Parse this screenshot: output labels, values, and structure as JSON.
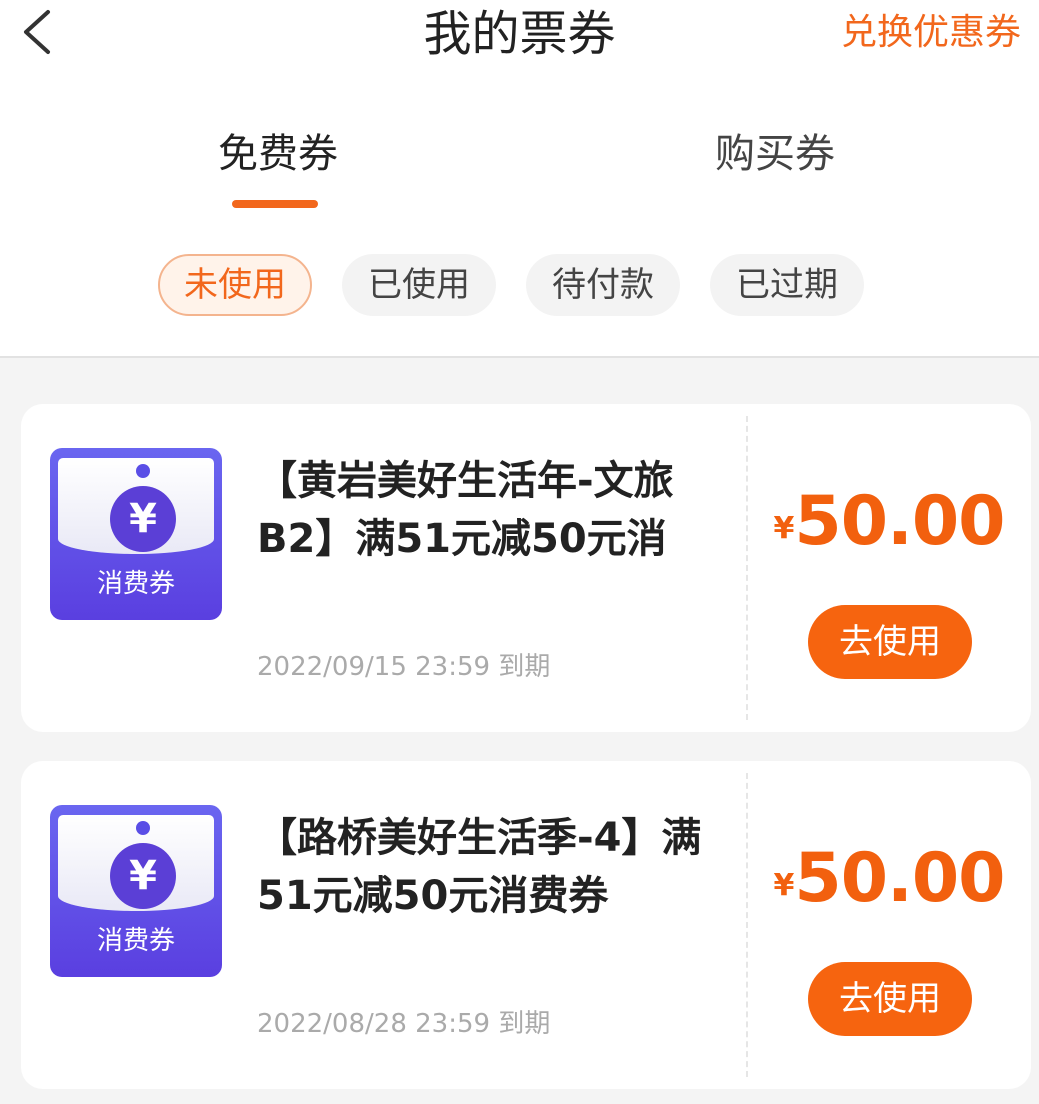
{
  "header": {
    "title": "我的票券",
    "exchange_label": "兑换优惠券"
  },
  "tabs": [
    {
      "label": "免费券",
      "active": true
    },
    {
      "label": "购买券",
      "active": false
    }
  ],
  "filters": [
    {
      "label": "未使用",
      "active": true
    },
    {
      "label": "已使用",
      "active": false
    },
    {
      "label": "待付款",
      "active": false
    },
    {
      "label": "已过期",
      "active": false
    }
  ],
  "coupons": [
    {
      "thumb_symbol": "¥",
      "thumb_label": "消费券",
      "title": "【黄岩美好生活年-文旅B2】满51元减50元消费…",
      "expiry": "2022/09/15 23:59 到期",
      "currency": "¥",
      "amount": "50.00",
      "button_label": "去使用"
    },
    {
      "thumb_symbol": "¥",
      "thumb_label": "消费券",
      "title": "【路桥美好生活季-4】满51元减50元消费券",
      "expiry": "2022/08/28 23:59 到期",
      "currency": "¥",
      "amount": "50.00",
      "button_label": "去使用"
    }
  ],
  "colors": {
    "accent": "#f2671c",
    "thumb_purple": "#5a3fe0"
  },
  "icons": {
    "back": "chevron-left-icon",
    "coupon": "yuan-coin-icon"
  }
}
